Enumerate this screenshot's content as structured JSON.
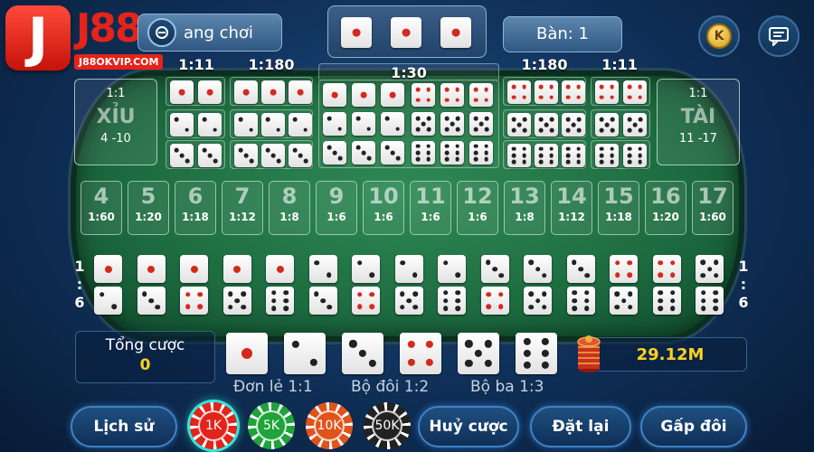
{
  "brand": {
    "logo_letter": "J",
    "name": "J88",
    "url": "J88OKVIP.COM"
  },
  "header": {
    "room_label": "ang chơi",
    "table_label": "Bàn: 1",
    "coin_letter": "K",
    "result_dice": [
      1,
      1,
      1
    ]
  },
  "odds_labels": {
    "single_triple": "1:11",
    "specific_triple": "1:180",
    "any_triple": "1:30",
    "specific_triple_right": "1:180",
    "single_triple_right": "1:11"
  },
  "small": {
    "odds": "1:1",
    "name": "XỈU",
    "range": "4 -10"
  },
  "big": {
    "odds": "1:1",
    "name": "TÀI",
    "range": "11 -17"
  },
  "totals": [
    {
      "num": "4",
      "odds": "1:60"
    },
    {
      "num": "5",
      "odds": "1:20"
    },
    {
      "num": "6",
      "odds": "1:18"
    },
    {
      "num": "7",
      "odds": "1:12"
    },
    {
      "num": "8",
      "odds": "1:8"
    },
    {
      "num": "9",
      "odds": "1:6"
    },
    {
      "num": "10",
      "odds": "1:6"
    },
    {
      "num": "11",
      "odds": "1:6"
    },
    {
      "num": "12",
      "odds": "1:6"
    },
    {
      "num": "13",
      "odds": "1:8"
    },
    {
      "num": "14",
      "odds": "1:12"
    },
    {
      "num": "15",
      "odds": "1:18"
    },
    {
      "num": "16",
      "odds": "1:20"
    },
    {
      "num": "17",
      "odds": "1:60"
    }
  ],
  "combo_odds": {
    "top": "1",
    "mid": ":",
    "bottom": "6"
  },
  "combos": [
    [
      1,
      2
    ],
    [
      1,
      3
    ],
    [
      1,
      4
    ],
    [
      1,
      5
    ],
    [
      1,
      6
    ],
    [
      2,
      3
    ],
    [
      2,
      4
    ],
    [
      2,
      5
    ],
    [
      2,
      6
    ],
    [
      3,
      4
    ],
    [
      3,
      5
    ],
    [
      3,
      6
    ],
    [
      4,
      5
    ],
    [
      4,
      6
    ],
    [
      5,
      6
    ]
  ],
  "bet_panel": {
    "label": "Tổng cược",
    "value": "0"
  },
  "single_dice": [
    1,
    2,
    3,
    4,
    5,
    6
  ],
  "balance": "29.12M",
  "payouts": {
    "single": "Đơn lẻ 1:1",
    "double": "Bộ đôi 1:2",
    "triple": "Bộ ba 1:3"
  },
  "buttons": {
    "history": "Lịch sử",
    "cancel": "Huỷ cược",
    "reset": "Đặt lại",
    "double": "Gấp đôi"
  },
  "chips": [
    {
      "label": "1K",
      "color": "#e3241b",
      "selected": true
    },
    {
      "label": "5K",
      "color": "#1fa33a",
      "selected": false
    },
    {
      "label": "10K",
      "color": "#e0541b",
      "selected": false
    },
    {
      "label": "50K",
      "color": "#222222",
      "selected": false
    }
  ]
}
